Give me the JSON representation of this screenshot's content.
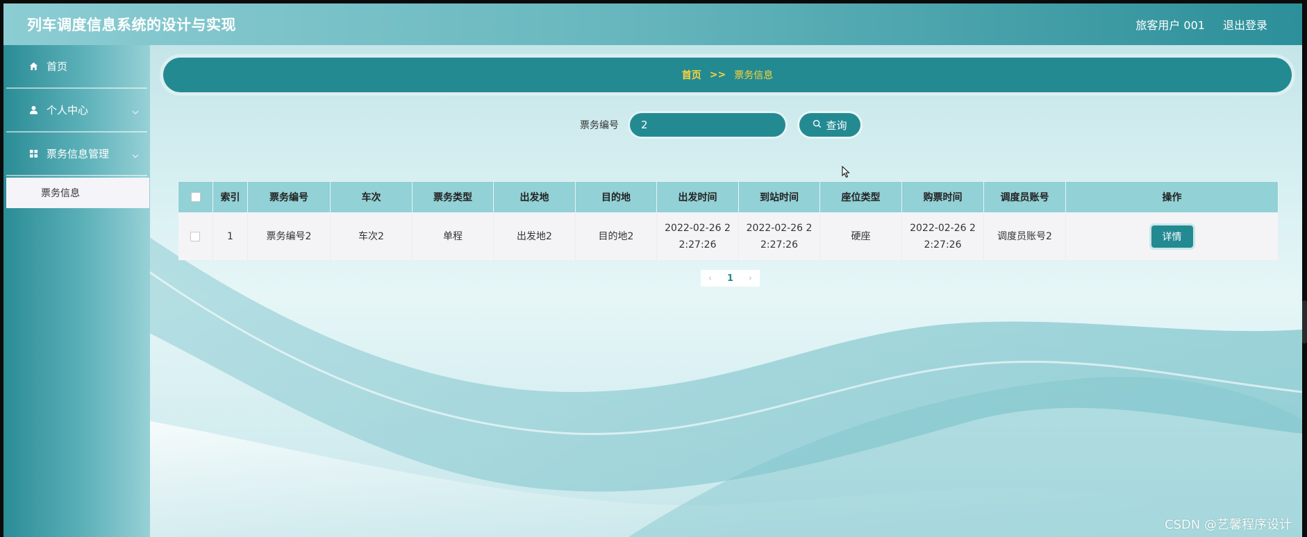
{
  "header": {
    "title": "列车调度信息系统的设计与实现",
    "user": "旅客用户 001",
    "logout": "退出登录"
  },
  "sidebar": {
    "items": [
      {
        "label": "首页",
        "icon": "home-icon"
      },
      {
        "label": "个人中心",
        "icon": "user-icon"
      },
      {
        "label": "票务信息管理",
        "icon": "grid-icon"
      }
    ],
    "submenu": {
      "label": "票务信息"
    }
  },
  "breadcrumb": {
    "home": "首页",
    "separator": ">>",
    "current": "票务信息"
  },
  "search": {
    "label": "票务编号",
    "value": "2",
    "button": "查询"
  },
  "table": {
    "headers": [
      "索引",
      "票务编号",
      "车次",
      "票务类型",
      "出发地",
      "目的地",
      "出发时间",
      "到站时间",
      "座位类型",
      "购票时间",
      "调度员账号",
      "操作"
    ],
    "rows": [
      {
        "index": "1",
        "ticket_no": "票务编号2",
        "train_no": "车次2",
        "ticket_type": "单程",
        "departure": "出发地2",
        "destination": "目的地2",
        "depart_time": "2022-02-26 2 2:27:26",
        "arrive_time": "2022-02-26 2 2:27:26",
        "seat_type": "硬座",
        "purchase_time": "2022-02-26 2 2:27:26",
        "dispatcher": "调度员账号2",
        "action": "详情"
      }
    ]
  },
  "pagination": {
    "prev": "‹",
    "current": "1",
    "next": "›"
  },
  "watermark": "CSDN @艺馨程序设计",
  "colors": {
    "primary": "#238a92",
    "header_th": "#92d1d6",
    "breadcrumb_text": "#ffd43b"
  }
}
